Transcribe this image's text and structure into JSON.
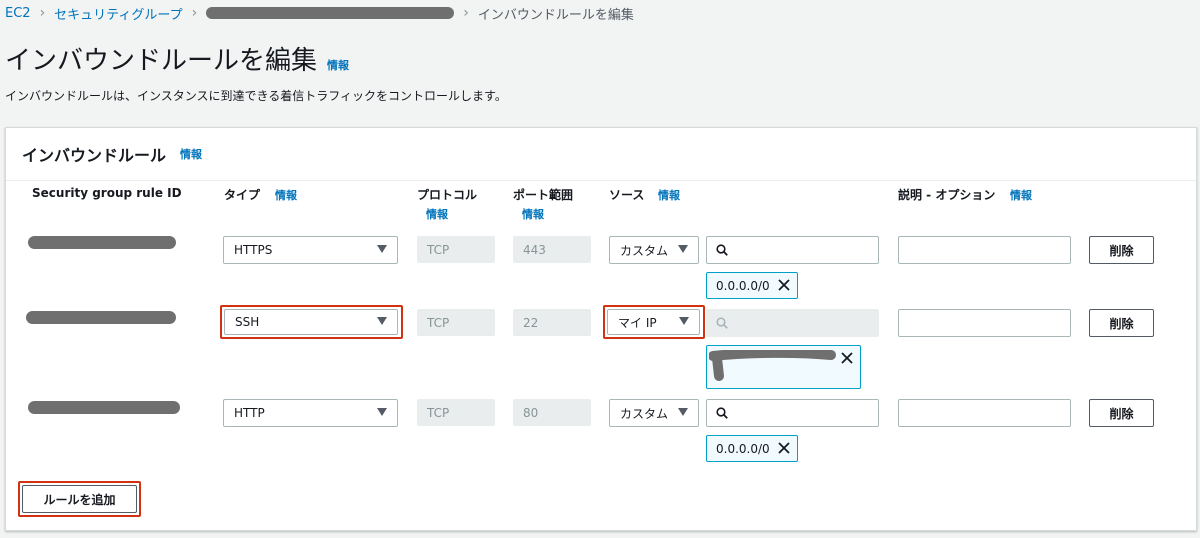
{
  "breadcrumb": {
    "ec2": "EC2",
    "security_groups": "セキュリティグループ",
    "current": "インバウンドルールを編集"
  },
  "page": {
    "title": "インバウンドルールを編集",
    "info": "情報",
    "description": "インバウンドルールは、インスタンスに到達できる着信トラフィックをコントロールします。"
  },
  "panel": {
    "title": "インバウンドルール",
    "info": "情報"
  },
  "columns": {
    "rule_id": "Security group rule ID",
    "type": "タイプ",
    "protocol": "プロトコル",
    "port_range": "ポート範囲",
    "source": "ソース",
    "description": "説明 - オプション",
    "info": "情報"
  },
  "rules": [
    {
      "type": "HTTPS",
      "protocol": "TCP",
      "port": "443",
      "source": "カスタム",
      "cidr": "0.0.0.0/0",
      "delete": "削除"
    },
    {
      "type": "SSH",
      "protocol": "TCP",
      "port": "22",
      "source": "マイ IP",
      "delete": "削除"
    },
    {
      "type": "HTTP",
      "protocol": "TCP",
      "port": "80",
      "source": "カスタム",
      "cidr": "0.0.0.0/0",
      "delete": "削除"
    }
  ],
  "add_rule_label": "ルールを追加",
  "colors": {
    "link": "#0073bb",
    "highlight": "#d13212",
    "token_border": "#00a1c9"
  }
}
